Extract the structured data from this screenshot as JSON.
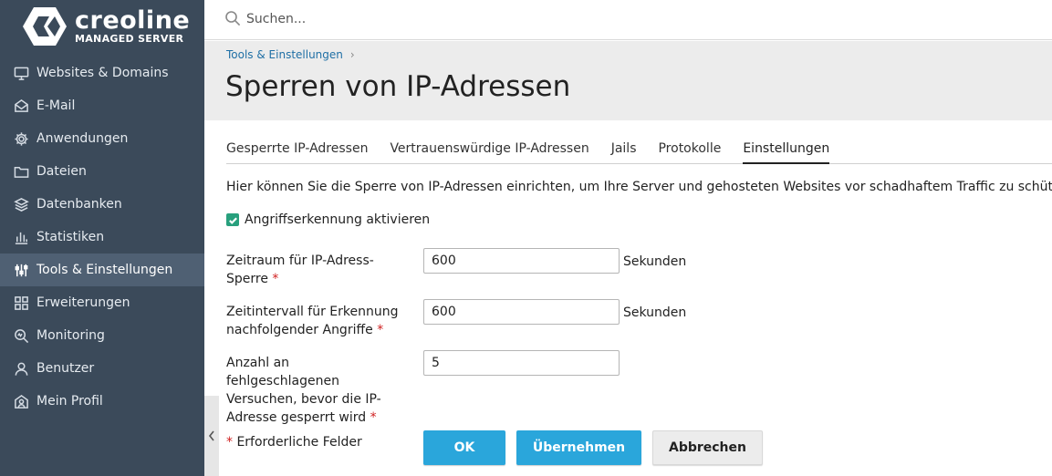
{
  "brand": {
    "name": "creoline",
    "subtitle": "MANAGED SERVER"
  },
  "sidebar": {
    "items": [
      {
        "label": "Websites & Domains",
        "icon": "monitor-icon"
      },
      {
        "label": "E-Mail",
        "icon": "mail-icon"
      },
      {
        "label": "Anwendungen",
        "icon": "gear-icon"
      },
      {
        "label": "Dateien",
        "icon": "folder-icon"
      },
      {
        "label": "Datenbanken",
        "icon": "layers-icon"
      },
      {
        "label": "Statistiken",
        "icon": "bar-chart-icon"
      },
      {
        "label": "Tools & Einstellungen",
        "icon": "sliders-icon",
        "active": true
      },
      {
        "label": "Erweiterungen",
        "icon": "puzzle-grid-icon"
      },
      {
        "label": "Monitoring",
        "icon": "monitoring-search-icon"
      },
      {
        "label": "Benutzer",
        "icon": "user-icon"
      },
      {
        "label": "Mein Profil",
        "icon": "profile-icon"
      }
    ]
  },
  "search": {
    "placeholder": "Suchen..."
  },
  "header": {
    "breadcrumb": "Tools & Einstellungen",
    "title": "Sperren von IP-Adressen"
  },
  "tabs": [
    {
      "label": "Gesperrte IP-Adressen"
    },
    {
      "label": "Vertrauenswürdige IP-Adressen"
    },
    {
      "label": "Jails"
    },
    {
      "label": "Protokolle"
    },
    {
      "label": "Einstellungen",
      "active": true
    }
  ],
  "main": {
    "intro": "Hier können Sie die Sperre von IP-Adressen einrichten, um Ihre Server und gehosteten Websites vor schadhaftem Traffic zu schützen.",
    "checkbox_label": "Angriffserkennung aktivieren",
    "fields": [
      {
        "label": "Zeitraum für IP-Adress-Sperre",
        "value": "600",
        "unit": "Sekunden"
      },
      {
        "label": "Zeitintervall für Erkennung nachfolgender Angriffe",
        "value": "600",
        "unit": "Sekunden"
      },
      {
        "label": "Anzahl an fehlgeschlagenen Versuchen, bevor die IP-Adresse gesperrt wird",
        "value": "5",
        "unit": ""
      }
    ],
    "required_star": "*",
    "required_note": "Erforderliche Felder"
  },
  "buttons": {
    "ok": "OK",
    "apply": "Übernehmen",
    "cancel": "Abbrechen"
  },
  "colors": {
    "sidebar_bg": "#3b4a5a",
    "sidebar_active": "#4f6073",
    "primary": "#2aa6db",
    "checkbox": "#28a07d",
    "link": "#1f6fa5"
  }
}
